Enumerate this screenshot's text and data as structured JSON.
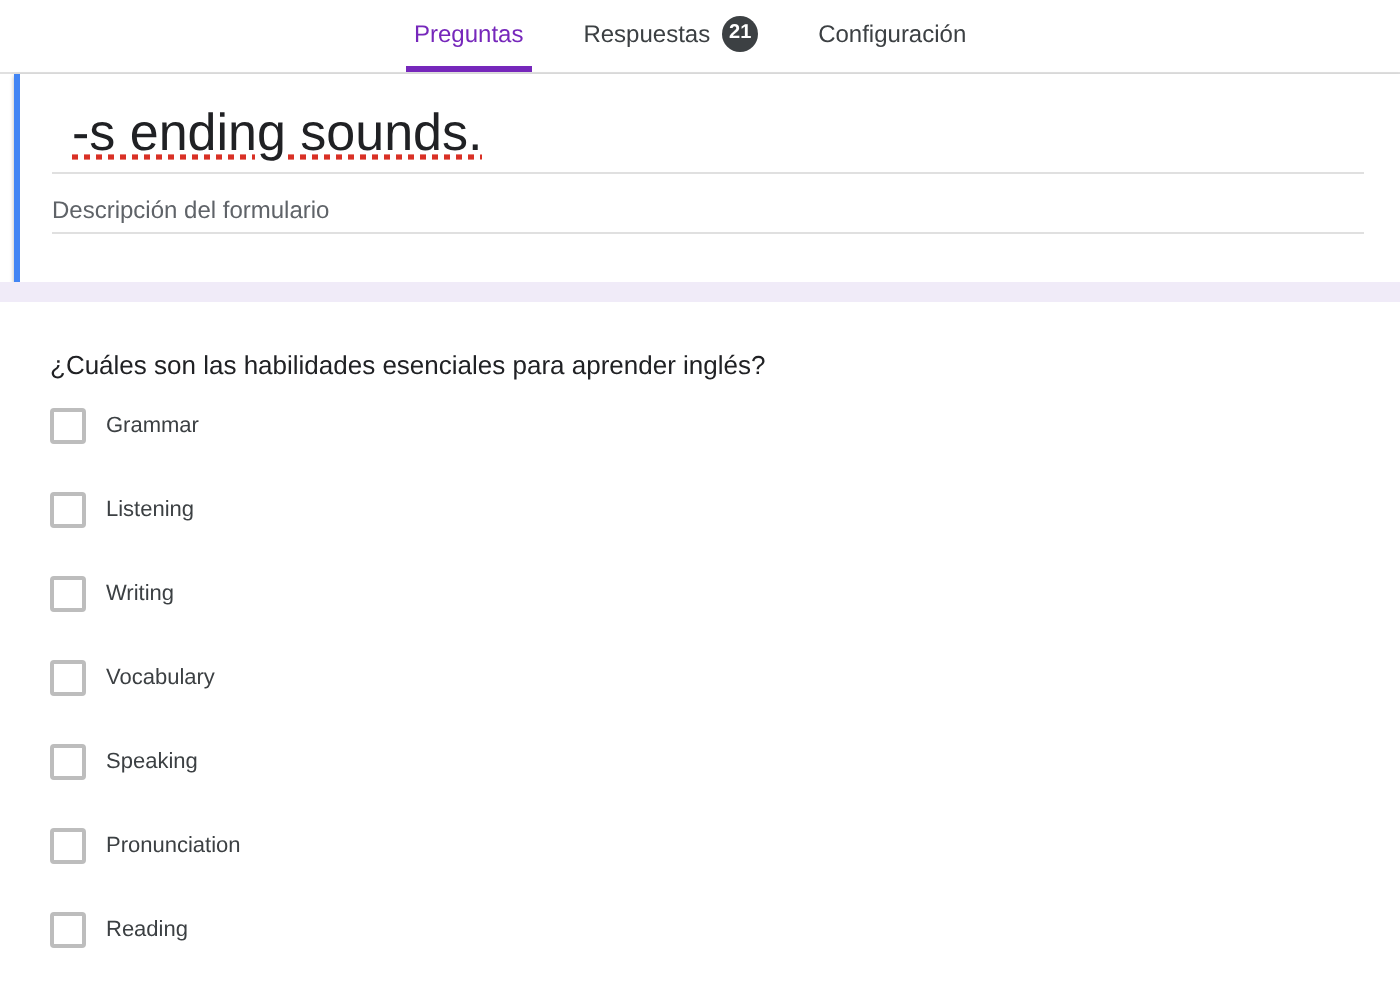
{
  "tabs": [
    {
      "label": "Preguntas",
      "selected": true
    },
    {
      "label": "Respuestas",
      "selected": false,
      "badge": "21"
    },
    {
      "label": "Configuración",
      "selected": false
    }
  ],
  "form": {
    "title": "-s ending sounds.",
    "description_placeholder": "Descripción del formulario"
  },
  "question": {
    "text": "¿Cuáles son las habilidades esenciales para aprender inglés?",
    "options": [
      {
        "label": "Grammar",
        "checked": false
      },
      {
        "label": "Listening",
        "checked": false
      },
      {
        "label": "Writing",
        "checked": false
      },
      {
        "label": "Vocabulary",
        "checked": false
      },
      {
        "label": "Speaking",
        "checked": false
      },
      {
        "label": "Pronunciation",
        "checked": false
      },
      {
        "label": "Reading",
        "checked": false
      }
    ]
  }
}
